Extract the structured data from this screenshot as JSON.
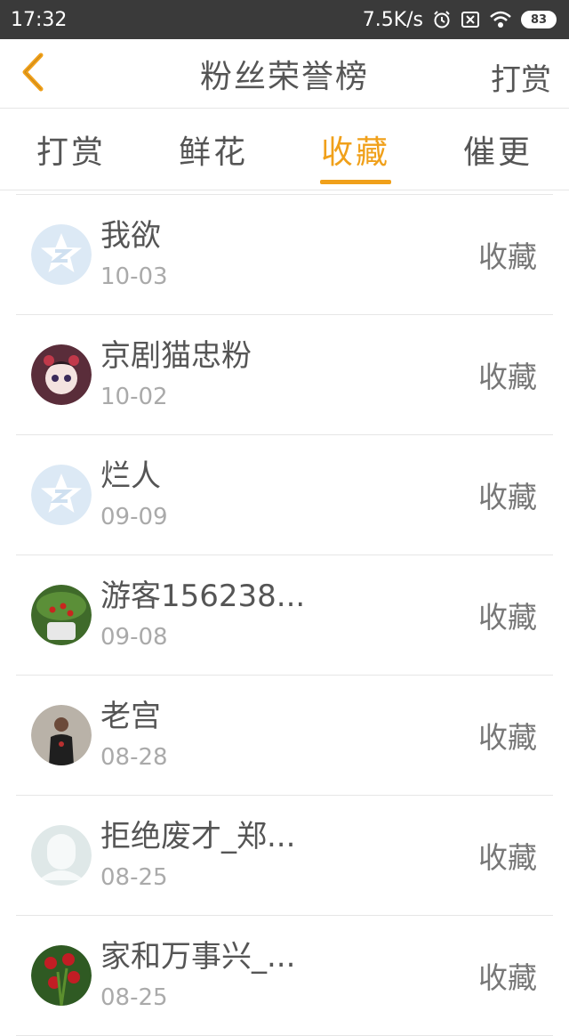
{
  "status_bar": {
    "time": "17:32",
    "network_speed": "7.5K/s",
    "battery": "83"
  },
  "header": {
    "title": "粉丝荣誉榜",
    "reward_link": "打赏"
  },
  "tabs": [
    {
      "label": "打赏",
      "active": false
    },
    {
      "label": "鲜花",
      "active": false
    },
    {
      "label": "收藏",
      "active": true
    },
    {
      "label": "催更",
      "active": false
    }
  ],
  "accent_color": "#f0a01a",
  "fans": [
    {
      "name": "我欲",
      "date": "10-03",
      "action": "收藏",
      "avatar": "default-star-avatar"
    },
    {
      "name": "京剧猫忠粉",
      "date": "10-02",
      "action": "收藏",
      "avatar": "anime-girl-avatar"
    },
    {
      "name": "烂人",
      "date": "09-09",
      "action": "收藏",
      "avatar": "default-star-avatar"
    },
    {
      "name": "游客156238...",
      "date": "09-08",
      "action": "收藏",
      "avatar": "plant-photo-avatar"
    },
    {
      "name": "老宫",
      "date": "08-28",
      "action": "收藏",
      "avatar": "person-photo-avatar"
    },
    {
      "name": "拒绝废才_郑...",
      "date": "08-25",
      "action": "收藏",
      "avatar": "blank-silhouette-avatar"
    },
    {
      "name": "家和万事兴_...",
      "date": "08-25",
      "action": "收藏",
      "avatar": "flower-photo-avatar"
    }
  ]
}
